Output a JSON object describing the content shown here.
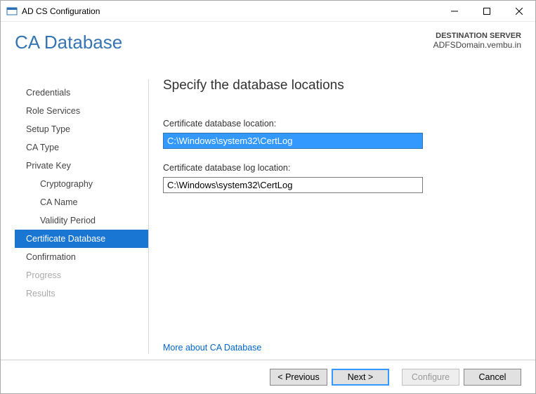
{
  "window": {
    "title": "AD CS Configuration"
  },
  "header": {
    "page_title": "CA Database",
    "dest_label": "DESTINATION SERVER",
    "dest_name": "ADFSDomain.vembu.in"
  },
  "sidebar": {
    "items": [
      {
        "label": "Credentials",
        "state": "normal",
        "sub": false
      },
      {
        "label": "Role Services",
        "state": "normal",
        "sub": false
      },
      {
        "label": "Setup Type",
        "state": "normal",
        "sub": false
      },
      {
        "label": "CA Type",
        "state": "normal",
        "sub": false
      },
      {
        "label": "Private Key",
        "state": "normal",
        "sub": false
      },
      {
        "label": "Cryptography",
        "state": "normal",
        "sub": true
      },
      {
        "label": "CA Name",
        "state": "normal",
        "sub": true
      },
      {
        "label": "Validity Period",
        "state": "normal",
        "sub": true
      },
      {
        "label": "Certificate Database",
        "state": "current",
        "sub": false
      },
      {
        "label": "Confirmation",
        "state": "normal",
        "sub": false
      },
      {
        "label": "Progress",
        "state": "disabled",
        "sub": false
      },
      {
        "label": "Results",
        "state": "disabled",
        "sub": false
      }
    ]
  },
  "panel": {
    "heading": "Specify the database locations",
    "db_label": "Certificate database location:",
    "db_value": "C:\\Windows\\system32\\CertLog",
    "log_label": "Certificate database log location:",
    "log_value": "C:\\Windows\\system32\\CertLog",
    "help_link": "More about CA Database"
  },
  "footer": {
    "previous": "< Previous",
    "next": "Next >",
    "configure": "Configure",
    "cancel": "Cancel"
  }
}
